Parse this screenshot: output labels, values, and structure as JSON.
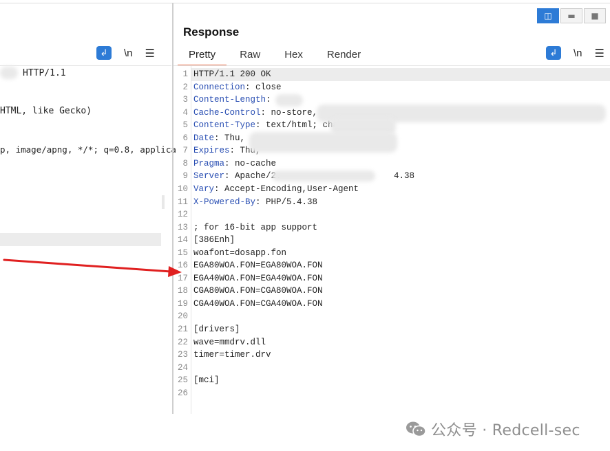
{
  "request_pane": {
    "icons": {
      "wrap": "wrap-lines-icon",
      "newline_label": "\\n",
      "menu": "hamburger-menu-icon"
    },
    "lines": [
      "HTTP/1.1",
      "HTML, like Gecko)",
      "p, image/apng, */*; q=0.8, applica"
    ]
  },
  "response_pane": {
    "title": "Response",
    "tabs": [
      "Pretty",
      "Raw",
      "Hex",
      "Render"
    ],
    "active_tab": "Pretty",
    "icons": {
      "wrap": "wrap-lines-icon",
      "newline_label": "\\n",
      "menu": "hamburger-menu-icon"
    },
    "view_toggle": [
      "split-view-icon",
      "horizontal-view-icon",
      "single-view-icon"
    ],
    "lines": [
      {
        "n": "1",
        "key": "",
        "val": "HTTP/1.1 200 OK"
      },
      {
        "n": "2",
        "key": "Connection",
        "val": ": close"
      },
      {
        "n": "3",
        "key": "Content-Length",
        "val": ":"
      },
      {
        "n": "4",
        "key": "Cache-Control",
        "val": ": no-store,"
      },
      {
        "n": "5",
        "key": "Content-Type",
        "val": ": text/html; char"
      },
      {
        "n": "6",
        "key": "Date",
        "val": ": Thu,"
      },
      {
        "n": "7",
        "key": "Expires",
        "val": ": Thu,"
      },
      {
        "n": "8",
        "key": "Pragma",
        "val": ": no-cache"
      },
      {
        "n": "9",
        "key": "Server",
        "val": ": Apache/2."
      },
      {
        "n": "10",
        "key": "Vary",
        "val": ": Accept-Encoding,User-Agent"
      },
      {
        "n": "11",
        "key": "X-Powered-By",
        "val": ": PHP/5.4.38"
      },
      {
        "n": "12",
        "key": "",
        "val": ""
      },
      {
        "n": "13",
        "key": "",
        "val": "; for 16-bit app support"
      },
      {
        "n": "14",
        "key": "",
        "val": "[386Enh]"
      },
      {
        "n": "15",
        "key": "",
        "val": "woafont=dosapp.fon"
      },
      {
        "n": "16",
        "key": "",
        "val": "EGA80WOA.FON=EGA80WOA.FON"
      },
      {
        "n": "17",
        "key": "",
        "val": "EGA40WOA.FON=EGA40WOA.FON"
      },
      {
        "n": "18",
        "key": "",
        "val": "CGA80WOA.FON=CGA80WOA.FON"
      },
      {
        "n": "19",
        "key": "",
        "val": "CGA40WOA.FON=CGA40WOA.FON"
      },
      {
        "n": "20",
        "key": "",
        "val": ""
      },
      {
        "n": "21",
        "key": "",
        "val": "[drivers]"
      },
      {
        "n": "22",
        "key": "",
        "val": "wave=mmdrv.dll"
      },
      {
        "n": "23",
        "key": "",
        "val": "timer=timer.drv"
      },
      {
        "n": "24",
        "key": "",
        "val": ""
      },
      {
        "n": "25",
        "key": "",
        "val": "[mci]"
      },
      {
        "n": "26",
        "key": "",
        "val": ""
      }
    ],
    "server_suffix": "4.38"
  },
  "annotation": {
    "arrow_color": "#e02020"
  },
  "watermark": {
    "text": "公众号 · Redcell-sec",
    "icon": "wechat-icon"
  },
  "colors": {
    "accent": "#2d7bd6",
    "tab_underline": "#e8704b",
    "header_key": "#2a4fb3"
  }
}
